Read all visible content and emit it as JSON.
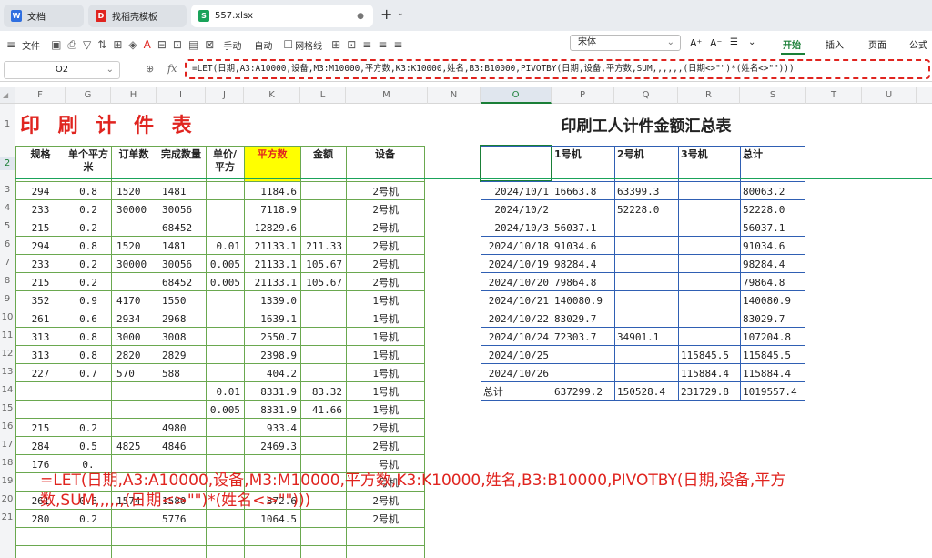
{
  "tabs": [
    {
      "label": "文档",
      "icon": "W"
    },
    {
      "label": "找稻壳模板",
      "icon": "D"
    },
    {
      "label": "557.xlsx",
      "icon": "S"
    }
  ],
  "tab_add": "+",
  "toolbar": {
    "file": "文件",
    "manual": "手动",
    "auto": "自动",
    "gridline": "网格线",
    "font": "宋体",
    "ribbon": [
      "开始",
      "插入",
      "页面",
      "公式"
    ]
  },
  "formula_bar": {
    "cell": "O2",
    "fx": "fx",
    "formula": "=LET(日期,A3:A10000,设备,M3:M10000,平方数,K3:K10000,姓名,B3:B10000,PIVOTBY(日期,设备,平方数,SUM,,,,,,(日期<>\"\")*(姓名<>\"\")))"
  },
  "columns": [
    "F",
    "G",
    "H",
    "I",
    "J",
    "K",
    "L",
    "M",
    "N",
    "O",
    "P",
    "Q",
    "R",
    "S",
    "T",
    "U"
  ],
  "rows": [
    "1",
    "2",
    "3",
    "4",
    "5",
    "6",
    "7",
    "8",
    "9",
    "10",
    "11",
    "12",
    "13",
    "14",
    "15",
    "16",
    "17",
    "18",
    "19",
    "20",
    "21"
  ],
  "left_table": {
    "title": "印 刷 计 件 表",
    "headers": [
      "规格",
      "单个平方米",
      "订单数",
      "完成数量",
      "单价/平方",
      "平方数",
      "金额",
      "设备"
    ],
    "rows": [
      [
        "294",
        "0.8",
        "1520",
        "1481",
        "",
        "1184.6",
        "",
        "2号机"
      ],
      [
        "233",
        "0.2",
        "30000",
        "30056",
        "",
        "7118.9",
        "",
        "2号机"
      ],
      [
        "215",
        "0.2",
        "",
        "68452",
        "",
        "12829.6",
        "",
        "2号机"
      ],
      [
        "294",
        "0.8",
        "1520",
        "1481",
        "0.01",
        "21133.1",
        "211.33",
        "2号机"
      ],
      [
        "233",
        "0.2",
        "30000",
        "30056",
        "0.005",
        "21133.1",
        "105.67",
        "2号机"
      ],
      [
        "215",
        "0.2",
        "",
        "68452",
        "0.005",
        "21133.1",
        "105.67",
        "2号机"
      ],
      [
        "352",
        "0.9",
        "4170",
        "1550",
        "",
        "1339.0",
        "",
        "1号机"
      ],
      [
        "261",
        "0.6",
        "2934",
        "2968",
        "",
        "1639.1",
        "",
        "1号机"
      ],
      [
        "313",
        "0.8",
        "3000",
        "3008",
        "",
        "2550.7",
        "",
        "1号机"
      ],
      [
        "313",
        "0.8",
        "2820",
        "2829",
        "",
        "2398.9",
        "",
        "1号机"
      ],
      [
        "227",
        "0.7",
        "570",
        "588",
        "",
        "404.2",
        "",
        "1号机"
      ],
      [
        "",
        "",
        "",
        "",
        "0.01",
        "8331.9",
        "83.32",
        "1号机"
      ],
      [
        "",
        "",
        "",
        "",
        "0.005",
        "8331.9",
        "41.66",
        "1号机"
      ],
      [
        "215",
        "0.2",
        "",
        "4980",
        "",
        "933.4",
        "",
        "2号机"
      ],
      [
        "284",
        "0.5",
        "4825",
        "4846",
        "",
        "2469.3",
        "",
        "2号机"
      ],
      [
        "176",
        "0.",
        "",
        "",
        "",
        "",
        "",
        "号机"
      ],
      [
        "",
        "",
        "",
        "",
        "",
        "",
        "",
        "号机"
      ],
      [
        "261",
        "0.6",
        "1574",
        "1580",
        "",
        "872.6",
        "",
        "2号机"
      ],
      [
        "280",
        "0.2",
        "",
        "5776",
        "",
        "1064.5",
        "",
        "2号机"
      ]
    ]
  },
  "pivot": {
    "title": "印刷工人计件金额汇总表",
    "headers": [
      "",
      "1号机",
      "2号机",
      "3号机",
      "总计"
    ],
    "rows": [
      [
        "2024/10/1",
        "16663.8",
        "63399.3",
        "",
        "80063.2"
      ],
      [
        "2024/10/2",
        "",
        "52228.0",
        "",
        "52228.0"
      ],
      [
        "2024/10/3",
        "56037.1",
        "",
        "",
        "56037.1"
      ],
      [
        "2024/10/18",
        "91034.6",
        "",
        "",
        "91034.6"
      ],
      [
        "2024/10/19",
        "98284.4",
        "",
        "",
        "98284.4"
      ],
      [
        "2024/10/20",
        "79864.8",
        "",
        "",
        "79864.8"
      ],
      [
        "2024/10/21",
        "140080.9",
        "",
        "",
        "140080.9"
      ],
      [
        "2024/10/22",
        "83029.7",
        "",
        "",
        "83029.7"
      ],
      [
        "2024/10/24",
        "72303.7",
        "34901.1",
        "",
        "107204.8"
      ],
      [
        "2024/10/25",
        "",
        "",
        "115845.5",
        "115845.5"
      ],
      [
        "2024/10/26",
        "",
        "",
        "115884.4",
        "115884.4"
      ]
    ],
    "total": [
      "总计",
      "637299.2",
      "150528.4",
      "231729.8",
      "1019557.4"
    ]
  },
  "overlay": {
    "line1": "=LET(日期,A3:A10000,设备,M3:M10000,平方数,K3:K10000,姓名,B3:B10000,PIVOTBY(日期,设备,平方",
    "line2": "数,SUM,,,,,,(日期<>\"\")*(姓名<>\"\")))"
  },
  "colors": {
    "accent": "#e0241f",
    "header_fill": "#ffff00",
    "green_grid": "#6aa84f",
    "blue_grid": "#2f5fb3"
  }
}
